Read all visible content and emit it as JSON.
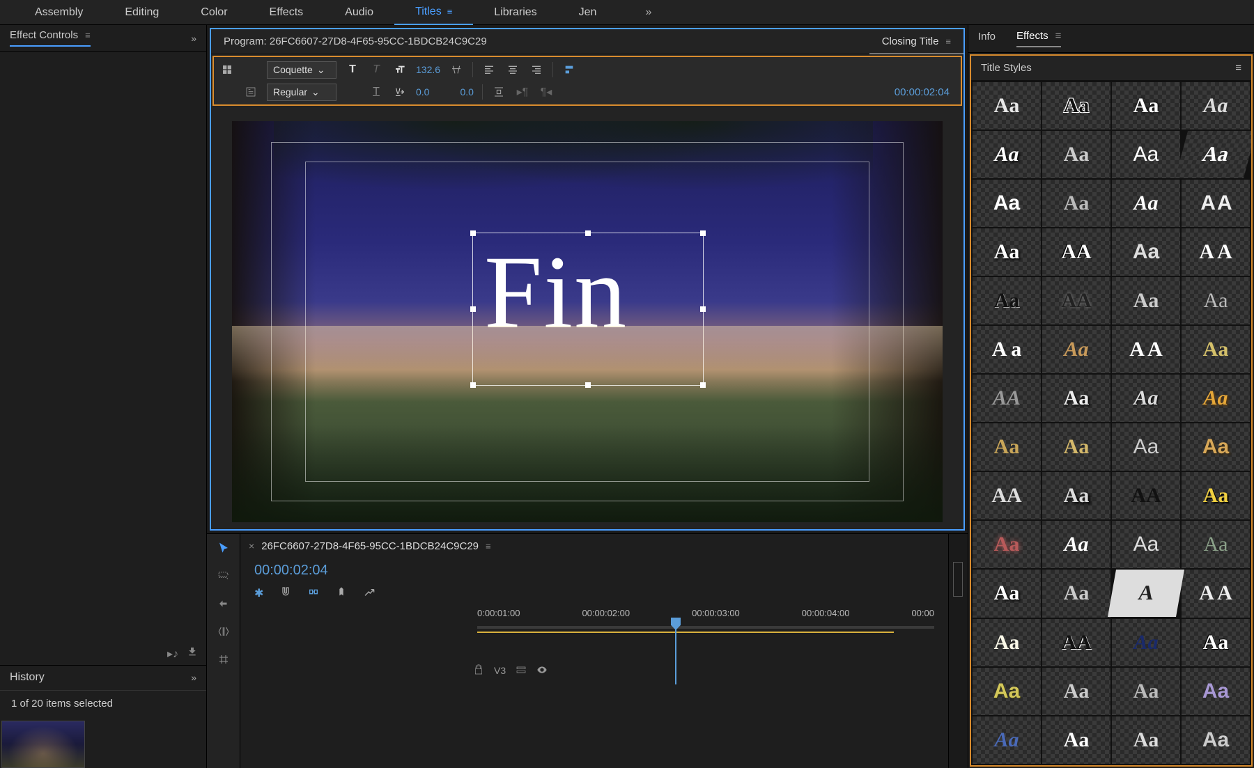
{
  "workspaces": {
    "items": [
      "Assembly",
      "Editing",
      "Color",
      "Effects",
      "Audio",
      "Titles",
      "Libraries",
      "Jen"
    ],
    "active_index": 5
  },
  "left_panel": {
    "title": "Effect Controls",
    "history_title": "History",
    "status": "1 of 20 items selected"
  },
  "program": {
    "main_tab": "Program: 26FC6607-27D8-4F65-95CC-1BDCB24C9C29",
    "sub_tab": "Closing Title",
    "title_text": "Fin"
  },
  "title_toolbar": {
    "font": "Coquette",
    "weight": "Regular",
    "font_size": "132.6",
    "tracking": "0.0",
    "leading": "0.0",
    "timecode": "00:00:02:04"
  },
  "timeline": {
    "sequence_name": "26FC6607-27D8-4F65-95CC-1BDCB24C9C29",
    "timecode": "00:00:02:04",
    "ruler": [
      "0:00:01:00",
      "00:00:02:00",
      "00:00:03:00",
      "00:00:04:00",
      "00:00"
    ],
    "track_label": "V3"
  },
  "right_panel": {
    "tabs": [
      "Info",
      "Effects"
    ],
    "active_index": 1,
    "styles_title": "Title Styles",
    "styles": [
      {
        "t": "Aa",
        "c": "#e8e8e8",
        "f": "Georgia"
      },
      {
        "t": "Aa",
        "c": "#111",
        "s": "1px 1px 0 #fff, -1px -1px 0 #fff, 1px -1px 0 #fff, -1px 1px 0 #fff",
        "f": "Georgia"
      },
      {
        "t": "Aa",
        "c": "#fff",
        "s": "0 0 6px #000",
        "f": "Georgia"
      },
      {
        "t": "Aa",
        "c": "#ddd",
        "f": "'Brush Script MT',cursive",
        "i": true
      },
      {
        "t": "Aa",
        "c": "#fff",
        "f": "'Brush Script MT',cursive",
        "i": true,
        "s": "2px 2px 4px #000"
      },
      {
        "t": "Aa",
        "c": "#ccc",
        "f": "Georgia"
      },
      {
        "t": "Aa",
        "c": "#fff",
        "f": "Arial",
        "w": "300"
      },
      {
        "t": "Aa",
        "c": "#fff",
        "f": "Impact",
        "sk": "-15deg",
        "w": "900"
      },
      {
        "t": "Aa",
        "c": "#fff",
        "f": "Arial",
        "w": "bold"
      },
      {
        "t": "Aa",
        "c": "#bbb",
        "f": "'Comic Sans MS',cursive"
      },
      {
        "t": "Aa",
        "c": "#fff",
        "f": "Impact",
        "i": true
      },
      {
        "t": "A A",
        "c": "#eee",
        "f": "Arial",
        "ls": "-2px"
      },
      {
        "t": "Aa",
        "c": "#fff",
        "f": "Georgia",
        "w": "bold",
        "s": "2px 2px 3px #000"
      },
      {
        "t": "AA",
        "c": "#fff",
        "f": "Georgia",
        "s": "1px 1px 0 #000, -1px -1px 0 #000"
      },
      {
        "t": "Aa",
        "c": "#ddd",
        "f": "Arial"
      },
      {
        "t": "A A",
        "c": "#fff",
        "f": "Arial Narrow"
      },
      {
        "t": "Aa",
        "c": "#111",
        "f": "Arial Black",
        "s": "1px 1px 0 #aaa"
      },
      {
        "t": "AA",
        "c": "#222",
        "f": "Georgia",
        "s": "0 0 4px #888"
      },
      {
        "t": "Aa",
        "c": "#ccc",
        "f": "Georgia"
      },
      {
        "t": "Aa",
        "c": "#bbb",
        "f": "Georgia",
        "w": "300"
      },
      {
        "t": "A a",
        "c": "#fff",
        "f": "Georgia"
      },
      {
        "t": "Aa",
        "c": "#c89a5a",
        "f": "Georgia",
        "i": true
      },
      {
        "t": "A A",
        "c": "#fff",
        "f": "Georgia"
      },
      {
        "t": "Aa",
        "c": "#d4c06a",
        "f": "Georgia"
      },
      {
        "t": "AA",
        "c": "#999",
        "f": "Georgia",
        "i": true
      },
      {
        "t": "Aa",
        "c": "#eee",
        "f": "Georgia",
        "s": "2px 2px 3px #000"
      },
      {
        "t": "Aa",
        "c": "#ddd",
        "f": "Georgia",
        "i": true,
        "s": "1px 1px 2px #000"
      },
      {
        "t": "Aa",
        "c": "#e6a738",
        "f": "'Brush Script MT',cursive",
        "i": true,
        "w": "bold",
        "s": "2px 2px 3px #5a3a10"
      },
      {
        "t": "Aa",
        "c": "#c8a558",
        "f": "Georgia"
      },
      {
        "t": "Aa",
        "c": "#d4b86a",
        "f": "Georgia"
      },
      {
        "t": "Aa",
        "c": "#ccc",
        "f": "Arial",
        "w": "300"
      },
      {
        "t": "Aa",
        "c": "#d8a858",
        "f": "Arial",
        "w": "bold",
        "s": "2px 2px 3px #3a2a10"
      },
      {
        "t": "AA",
        "c": "#ddd",
        "f": "Arial Narrow"
      },
      {
        "t": "Aa",
        "c": "#ddd",
        "f": "Georgia",
        "s": "3px 3px 4px #000"
      },
      {
        "t": "AA",
        "c": "#111",
        "f": "Arial Black"
      },
      {
        "t": "Aa",
        "c": "#f0d040",
        "f": "'Comic Sans MS',cursive",
        "w": "bold",
        "s": "2px 2px 0 #000"
      },
      {
        "t": "Aa",
        "c": "#b85a5a",
        "f": "Georgia",
        "s": "0 0 8px #b85a5a"
      },
      {
        "t": "Aa",
        "c": "#fff",
        "f": "Georgia",
        "i": true,
        "w": "bold"
      },
      {
        "t": "Aa",
        "c": "#ddd",
        "f": "Arial",
        "w": "300"
      },
      {
        "t": "Aa",
        "c": "#8aa088",
        "f": "Georgia",
        "w": "300"
      },
      {
        "t": "Aa",
        "c": "#fff",
        "f": "Arial Black",
        "s": "2px 2px 3px #000"
      },
      {
        "t": "Aa",
        "c": "#ccc",
        "f": "Georgia"
      },
      {
        "t": "A",
        "c": "#222",
        "f": "Impact",
        "bg": "#ddd",
        "sk": "-10deg"
      },
      {
        "t": "A A",
        "c": "#eee",
        "f": "Arial Narrow"
      },
      {
        "t": "Aa",
        "c": "#faf8e8",
        "f": "Georgia"
      },
      {
        "t": "AA",
        "c": "#111",
        "f": "Impact",
        "s": "1px 1px 0 #fff"
      },
      {
        "t": "Aa",
        "c": "#1a2a6a",
        "f": "Georgia",
        "i": true,
        "w": "bold"
      },
      {
        "t": "Aa",
        "c": "#fff",
        "f": "Arial Black",
        "s": "-1px -1px 0 #000,1px 1px 0 #000"
      },
      {
        "t": "Aa",
        "c": "#d4c85a",
        "f": "Arial",
        "s": "1px 1px 0 #3a3a10"
      },
      {
        "t": "Aa",
        "c": "#ccc",
        "f": "Georgia"
      },
      {
        "t": "Aa",
        "c": "#bbb",
        "f": "Georgia"
      },
      {
        "t": "Aa",
        "c": "#a898d4",
        "f": "Arial",
        "w": "bold"
      },
      {
        "t": "Aa",
        "c": "#4a6ab8",
        "f": "Georgia",
        "i": true
      },
      {
        "t": "Aa",
        "c": "#fff",
        "f": "Arial Black"
      },
      {
        "t": "Aa",
        "c": "#ddd",
        "f": "Georgia"
      },
      {
        "t": "Aa",
        "c": "#ccc",
        "f": "Arial"
      }
    ]
  }
}
